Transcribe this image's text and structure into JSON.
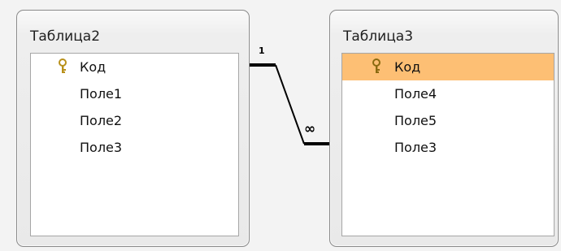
{
  "tables": [
    {
      "title": "Таблица2",
      "fields": [
        {
          "label": "Код",
          "is_key": true,
          "selected": false
        },
        {
          "label": "Поле1",
          "is_key": false,
          "selected": false
        },
        {
          "label": "Поле2",
          "is_key": false,
          "selected": false
        },
        {
          "label": "Поле3",
          "is_key": false,
          "selected": false
        }
      ]
    },
    {
      "title": "Таблица3",
      "fields": [
        {
          "label": "Код",
          "is_key": true,
          "selected": true
        },
        {
          "label": "Поле4",
          "is_key": false,
          "selected": false
        },
        {
          "label": "Поле5",
          "is_key": false,
          "selected": false
        },
        {
          "label": "Поле3",
          "is_key": false,
          "selected": false
        }
      ]
    }
  ],
  "relationship": {
    "one_side": "1",
    "many_side": "∞"
  },
  "colors": {
    "selected_row": "#fdbf74",
    "key_icon": "#c9a227",
    "line": "#000000"
  },
  "icons": {
    "key": "key-icon"
  }
}
